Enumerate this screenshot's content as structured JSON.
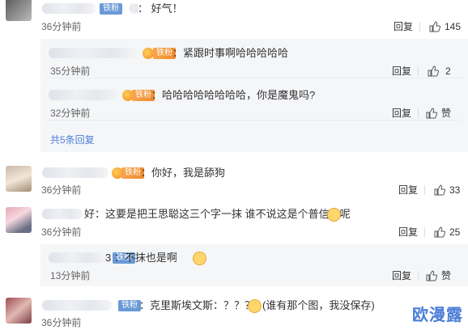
{
  "comments": [
    {
      "text": "：  好气！",
      "time": "36分钟前",
      "reply": "回复",
      "likes": "145",
      "badge": "铁粉"
    },
    {
      "text": "：紧跟时事啊哈哈哈哈哈",
      "time": "35分钟前",
      "reply": "回复",
      "likes": "2",
      "badge": "铁粉"
    },
    {
      "text": "：哈哈哈哈哈哈哈哈，你是魔鬼吗?",
      "time": "32分钟前",
      "reply": "回复",
      "likes": "赞",
      "badge": "铁粉"
    },
    {
      "text": "：你好，我是舔狗",
      "time": "36分钟前",
      "reply": "回复",
      "likes": "33",
      "badge": "铁粉"
    },
    {
      "text": "好：这要是把王思聪这三个字一抹 谁不说这是个普信男呢",
      "time": "36分钟前",
      "reply": "回复",
      "likes": "25"
    },
    {
      "text": "3  ：不抹也是啊",
      "time": "13分钟前",
      "reply": "回复",
      "likes": "赞",
      "badge": "铁粉"
    },
    {
      "text": "：克里斯埃文斯：？？？",
      "text2": "(谁有那个图，我没保存)",
      "time": "36分钟前",
      "badge": "铁粉"
    }
  ],
  "more_replies": "共5条回复",
  "watermark": "欧漫露",
  "icons": {
    "like": "thumbs-up-icon",
    "emoji": "cat-emoji-icon",
    "medal": "medal-icon"
  },
  "colors": {
    "badge_blue": "#6a9ad6",
    "badge_orange": "#f08a2b",
    "link": "#4c7ed6"
  }
}
